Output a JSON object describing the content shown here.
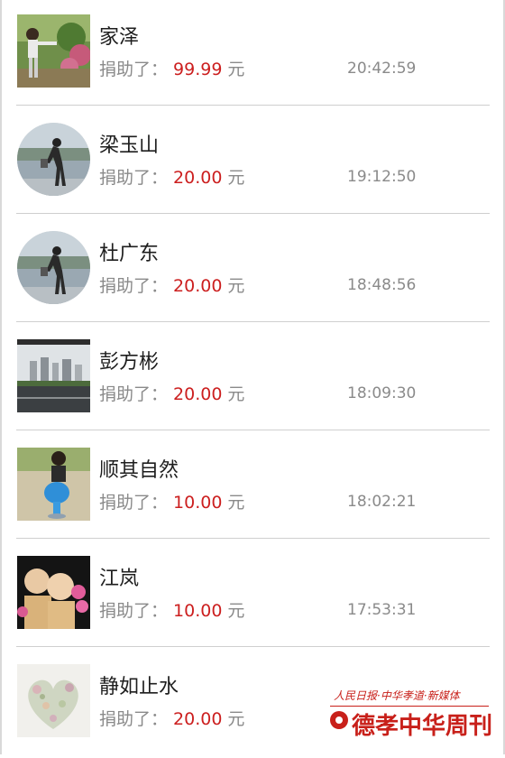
{
  "donation_label": "捐助了：",
  "currency_label": "元",
  "donations": [
    {
      "name": "家泽",
      "amount": "99.99",
      "time": "20:42:59",
      "avatar_icon": "child-photo-avatar"
    },
    {
      "name": "梁玉山",
      "amount": "20.00",
      "time": "19:12:50",
      "avatar_icon": "lakeside-person-avatar"
    },
    {
      "name": "杜广东",
      "amount": "20.00",
      "time": "18:48:56",
      "avatar_icon": "lakeside-person-avatar"
    },
    {
      "name": "彭方彬",
      "amount": "20.00",
      "time": "18:09:30",
      "avatar_icon": "city-skyline-avatar"
    },
    {
      "name": "顺其自然",
      "amount": "10.00",
      "time": "18:02:21",
      "avatar_icon": "toddler-on-toy-avatar"
    },
    {
      "name": "江岚",
      "amount": "10.00",
      "time": "17:53:31",
      "avatar_icon": "two-children-avatar"
    },
    {
      "name": "静如止水",
      "amount": "20.00",
      "time": "",
      "avatar_icon": "flower-heart-avatar"
    }
  ],
  "watermark": {
    "top_line": "人民日报·中华孝道·新媒体",
    "title": "德孝中华周刊"
  },
  "colors": {
    "amount": "#cc1f1f",
    "text_gray": "#8a8a8a",
    "name": "#1e1e1e",
    "watermark": "#c8201a"
  }
}
